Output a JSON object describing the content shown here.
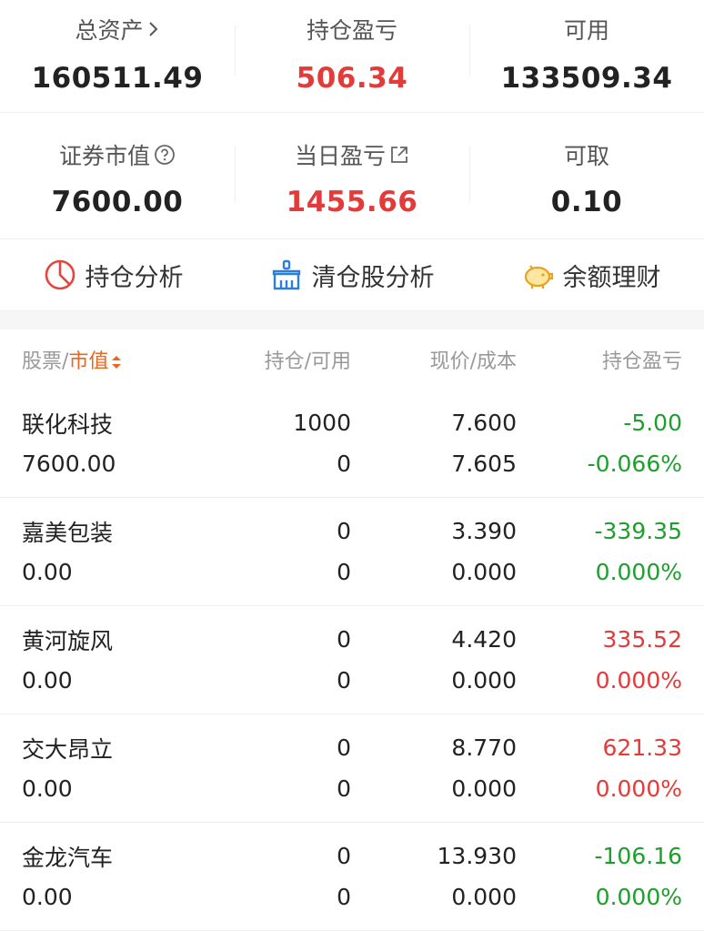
{
  "summary": {
    "total_assets_label": "总资产",
    "total_assets_value": "160511.49",
    "position_pl_label": "持仓盈亏",
    "position_pl_value": "506.34",
    "available_label": "可用",
    "available_value": "133509.34",
    "market_value_label": "证券市值",
    "market_value_value": "7600.00",
    "daily_pl_label": "当日盈亏",
    "daily_pl_value": "1455.66",
    "withdrawable_label": "可取",
    "withdrawable_value": "0.10"
  },
  "tools": {
    "position_analysis": "持仓分析",
    "cleared_analysis": "清仓股分析",
    "balance_finance": "余额理财"
  },
  "table": {
    "head_stock": "股票",
    "head_slash": "/",
    "head_market_value": "市值",
    "head_position": "持仓/可用",
    "head_price": "现价/成本",
    "head_pl": "持仓盈亏"
  },
  "rows": [
    {
      "name": "联化科技",
      "market_value": "7600.00",
      "position": "1000",
      "available": "0",
      "price": "7.600",
      "cost": "7.605",
      "pl": "-5.00",
      "pl_pct": "-0.066%",
      "pl_color": "green",
      "pct_color": "green"
    },
    {
      "name": "嘉美包装",
      "market_value": "0.00",
      "position": "0",
      "available": "0",
      "price": "3.390",
      "cost": "0.000",
      "pl": "-339.35",
      "pl_pct": "0.000%",
      "pl_color": "green",
      "pct_color": "green"
    },
    {
      "name": "黄河旋风",
      "market_value": "0.00",
      "position": "0",
      "available": "0",
      "price": "4.420",
      "cost": "0.000",
      "pl": "335.52",
      "pl_pct": "0.000%",
      "pl_color": "red",
      "pct_color": "red"
    },
    {
      "name": "交大昂立",
      "market_value": "0.00",
      "position": "0",
      "available": "0",
      "price": "8.770",
      "cost": "0.000",
      "pl": "621.33",
      "pl_pct": "0.000%",
      "pl_color": "red",
      "pct_color": "red"
    },
    {
      "name": "金龙汽车",
      "market_value": "0.00",
      "position": "0",
      "available": "0",
      "price": "13.930",
      "cost": "0.000",
      "pl": "-106.16",
      "pl_pct": "0.000%",
      "pl_color": "green",
      "pct_color": "green"
    }
  ],
  "colors": {
    "up": "#e33a3a",
    "down": "#1f9e2e",
    "accent": "#e8671f"
  }
}
